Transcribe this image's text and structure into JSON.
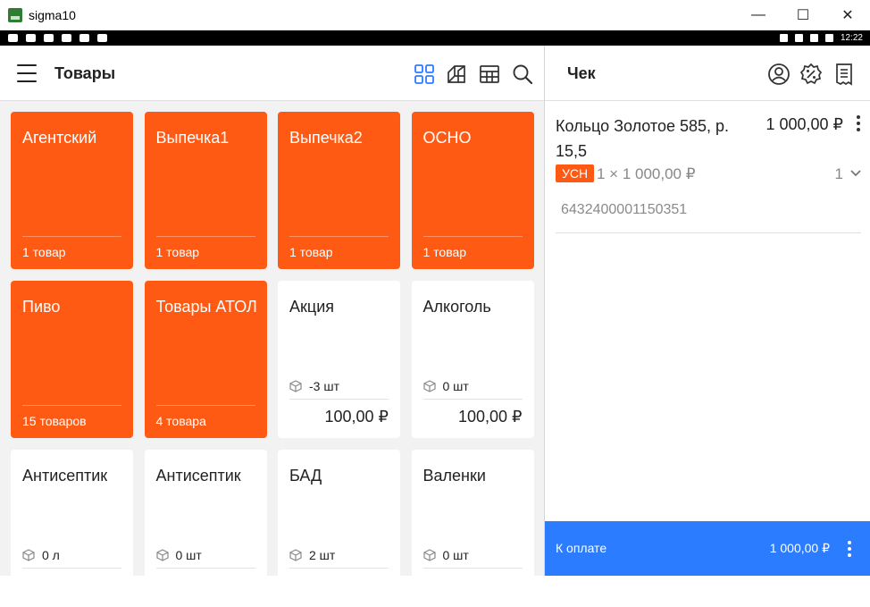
{
  "window": {
    "title": "sigma10",
    "controls": [
      "minimize-icon",
      "maximize-icon",
      "close-icon"
    ]
  },
  "statusbar": {
    "time": "12:22"
  },
  "left": {
    "title": "Товары",
    "header_icons": [
      "grid-view-icon",
      "tiles-view-icon",
      "table-view-icon",
      "search-icon"
    ]
  },
  "tiles": [
    {
      "kind": "category",
      "name": "Агентский",
      "count": "1 товар"
    },
    {
      "kind": "category",
      "name": "Выпечка1",
      "count": "1 товар"
    },
    {
      "kind": "category",
      "name": "Выпечка2",
      "count": "1 товар"
    },
    {
      "kind": "category",
      "name": "ОСНО",
      "count": "1 товар"
    },
    {
      "kind": "category",
      "name": "Пиво",
      "count": "15 товаров"
    },
    {
      "kind": "category",
      "name": "Товары АТОЛ",
      "count": "4 товара"
    },
    {
      "kind": "item",
      "name": "Акция",
      "qty": "-3 шт",
      "price": "100,00 ₽"
    },
    {
      "kind": "item",
      "name": "Алкоголь",
      "qty": "0 шт",
      "price": "100,00 ₽"
    },
    {
      "kind": "item",
      "name": "Антисептик",
      "qty": "0 л",
      "price": ""
    },
    {
      "kind": "item",
      "name": "Антисептик",
      "qty": "0 шт",
      "price": ""
    },
    {
      "kind": "item",
      "name": "БАД",
      "qty": "2 шт",
      "price": ""
    },
    {
      "kind": "item",
      "name": "Валенки",
      "qty": "0 шт",
      "price": ""
    }
  ],
  "right": {
    "title": "Чек",
    "header_icons": [
      "customer-icon",
      "discount-icon",
      "receipt-icon"
    ]
  },
  "receipt_item": {
    "name": "Кольцо Золотое 585, р. 15,5",
    "price": "1 000,00 ₽",
    "tax": "УСН",
    "unit_line": "1 × 1 000,00 ₽",
    "quantity": "1",
    "barcode": "6432400001150351"
  },
  "payment": {
    "label": "К оплате",
    "amount": "1 000,00 ₽"
  },
  "colors": {
    "category_tile": "#ff5a14",
    "pay_bar": "#2c7cff",
    "accent_icon": "#2c7cff"
  }
}
